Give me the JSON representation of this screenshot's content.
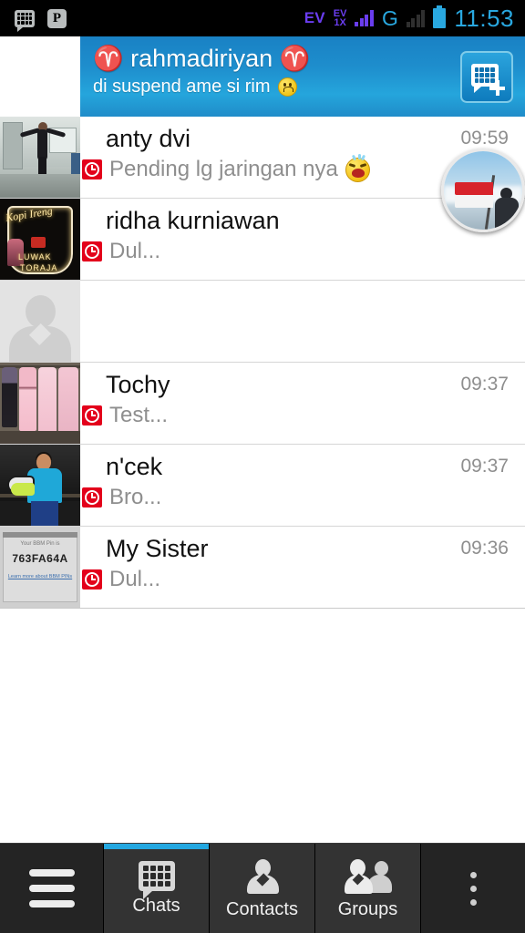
{
  "status_bar": {
    "icons": [
      "bbm-notification-icon",
      "path-app-icon"
    ],
    "network_label": "EV",
    "network_label_2_top": "EV",
    "network_label_2_bottom": "1X",
    "carrier_letter": "G",
    "time": "11:53"
  },
  "header": {
    "display_name": "♈ rahmadiriyan ♈",
    "status_message": "di suspend ame si rim",
    "status_emoji": "sad-face-emoji",
    "new_chat_label": "new-chat-button",
    "accent_color": "#1e8ecd"
  },
  "chats": {
    "pending_icon_color": "#e3001b",
    "items": [
      {
        "name": "anty dvi",
        "preview": "Pending lg jaringan nya",
        "time": "09:59",
        "pending": true,
        "emoji": "crying-face-emoji",
        "avatar": "person-jumping-photo"
      },
      {
        "name": "ridha kurniawan",
        "preview": "Dul...",
        "time": "",
        "pending": true,
        "emoji": "",
        "avatar": "coffee-neon-sign-photo"
      },
      {
        "name": "",
        "preview": "",
        "time": "",
        "pending": false,
        "emoji": "",
        "avatar": "default-person-placeholder"
      },
      {
        "name": "Tochy",
        "preview": "Test...",
        "time": "09:37",
        "pending": true,
        "emoji": "",
        "avatar": "dresses-photo"
      },
      {
        "name": "n'cek",
        "preview": "Bro...",
        "time": "09:37",
        "pending": true,
        "emoji": "",
        "avatar": "boy-with-shoes-photo"
      },
      {
        "name": "My Sister",
        "preview": "Dul...",
        "time": "09:36",
        "pending": true,
        "emoji": "",
        "avatar": "bbm-pin-screenshot-photo"
      }
    ],
    "floating_avatar": {
      "name": "flag-on-mountain-avatar",
      "pin_text": "763FA64A"
    }
  },
  "avatar_texts": {
    "coffee_line1": "Kopi Ireng",
    "coffee_line2": "LUWAK",
    "coffee_line3": "TORAJA",
    "pin_caption": "Your BBM Pin is",
    "pin_value": "763FA64A",
    "pin_link": "Learn more about BBM PINs"
  },
  "bottom_nav": {
    "menu_label": "menu-button",
    "tabs": [
      {
        "label": "Chats",
        "icon": "bbm-chats-icon",
        "active": true
      },
      {
        "label": "Contacts",
        "icon": "person-icon",
        "active": false
      },
      {
        "label": "Groups",
        "icon": "people-group-icon",
        "active": false
      }
    ],
    "overflow_label": "more-options-button",
    "active_indicator_color": "#23a7e0"
  }
}
